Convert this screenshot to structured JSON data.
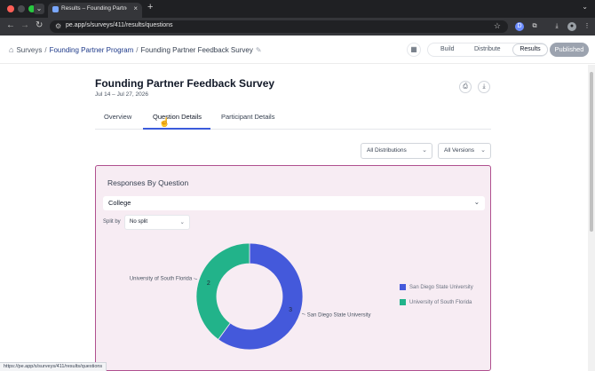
{
  "browser": {
    "tab_title": "Results – Founding Partner F",
    "url": "pe.app/s/surveys/411/results/questions"
  },
  "header": {
    "breadcrumb": {
      "root": "Surveys",
      "program": "Founding Partner Program",
      "current": "Founding Partner Feedback Survey"
    },
    "modes": {
      "build": "Build",
      "distribute": "Distribute",
      "results": "Results"
    },
    "status_button": "Published"
  },
  "survey": {
    "title": "Founding Partner Feedback Survey",
    "dates": "Jul 14 – Jul 27, 2026"
  },
  "tabs": [
    {
      "label": "Overview"
    },
    {
      "label": "Question Details",
      "active": true
    },
    {
      "label": "Participant Details"
    }
  ],
  "filters": {
    "distributions": "All Distributions",
    "versions": "All Versions"
  },
  "panel": {
    "title": "Responses By Question",
    "question": "College",
    "split_by_label": "Split by",
    "split_by_value": "No split"
  },
  "chart_data": {
    "type": "pie",
    "categories": [
      "San Diego State University",
      "University of South Florida"
    ],
    "values": [
      3,
      2
    ],
    "colors": [
      "#4459db",
      "#22b38a"
    ],
    "legend": "right"
  },
  "status_bar_url": "https://pe.app/s/surveys/411/results/questions",
  "icons": {
    "home": "home-icon",
    "edit": "pencil-icon",
    "calendar": "calendar-icon",
    "print": "print-icon",
    "download": "download-icon"
  }
}
